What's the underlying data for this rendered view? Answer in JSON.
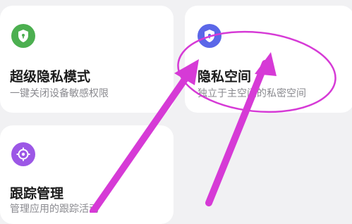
{
  "cards": [
    {
      "name": "card-super-privacy-mode",
      "title": "超级隐私模式",
      "subtitle": "一键关闭设备敏感权限",
      "icon": "shield-lock-icon",
      "color": "#4caf50"
    },
    {
      "name": "card-private-space",
      "title": "隐私空间",
      "subtitle": "独立于主空间的私密空间",
      "icon": "shield-lock-icon",
      "color": "#5b67e8"
    },
    {
      "name": "card-tracking-management",
      "title": "跟踪管理",
      "subtitle": "管理应用的跟踪活动",
      "icon": "target-icon",
      "color": "#9c57e6"
    }
  ],
  "annotation": {
    "color": "#d63ad6",
    "shape": "ellipse-highlight-with-arrows"
  }
}
